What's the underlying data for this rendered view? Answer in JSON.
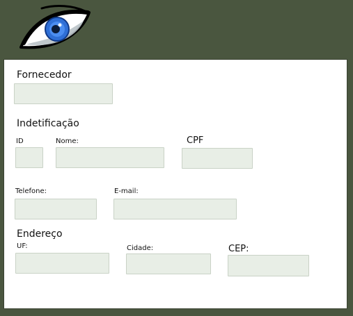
{
  "logo": {
    "icon": "eye-icon",
    "iris_color": "#2f6fd6"
  },
  "form": {
    "supplier_label": "Fornecedor",
    "supplier_value": "",
    "identification_label": "Indetificação",
    "id_label": "ID",
    "id_value": "",
    "name_label": "Nome:",
    "name_value": "",
    "cpf_label": "CPF",
    "cpf_value": "",
    "phone_label": "Telefone:",
    "phone_value": "",
    "email_label": "E-mail:",
    "email_value": "",
    "address_label": "Endereço",
    "uf_label": "UF:",
    "uf_value": "",
    "city_label": "Cidade:",
    "city_value": "",
    "cep_label": "CEP:",
    "cep_value": ""
  },
  "colors": {
    "background": "#4a563f",
    "panel": "#ffffff",
    "field_fill": "#e8eee6"
  }
}
